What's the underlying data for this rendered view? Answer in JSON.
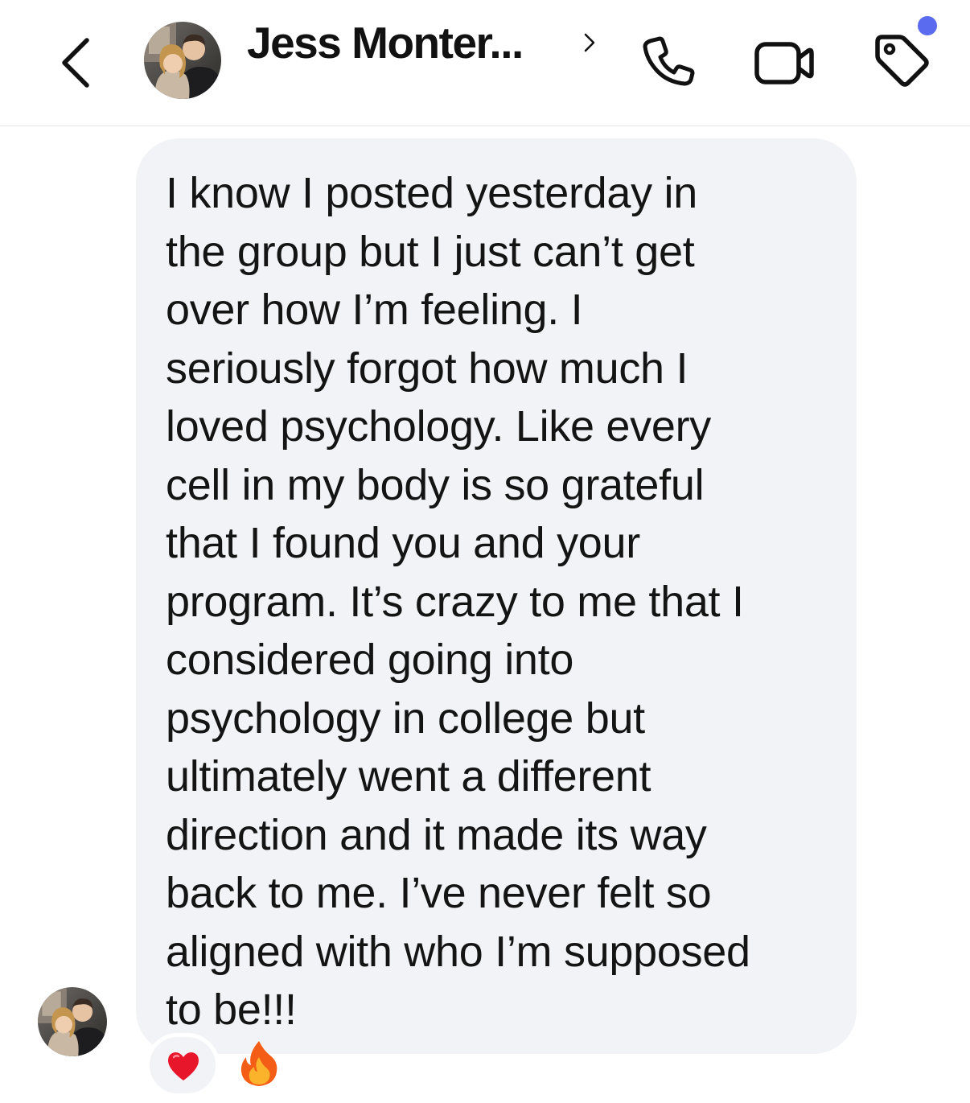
{
  "header": {
    "contact_name": "Jess Monter...",
    "chevron": "chevron-right-icon",
    "back_icon": "chevron-left-icon",
    "actions": [
      {
        "name": "phone-icon"
      },
      {
        "name": "video-camera-icon"
      },
      {
        "name": "tag-icon"
      }
    ],
    "notification_dot_color": "#5b6bf0"
  },
  "conversation": {
    "message": {
      "text": "I know I posted yesterday in\nthe group but I just can’t get\nover how I’m feeling. I\nseriously forgot how much I\nloved psychology. Like every\ncell in my body is so grateful\nthat I found you and your\nprogram. It’s crazy to me that I\nconsidered going into\npsychology in college but\nultimately went a different\ndirection and it made its way\nback to me. I’ve never felt so\naligned with who I’m supposed\nto be!!!",
      "emoji": [
        "fire-icon",
        "fire-icon"
      ],
      "bubble_color": "#f2f3f6",
      "reaction": "heart-icon"
    }
  }
}
